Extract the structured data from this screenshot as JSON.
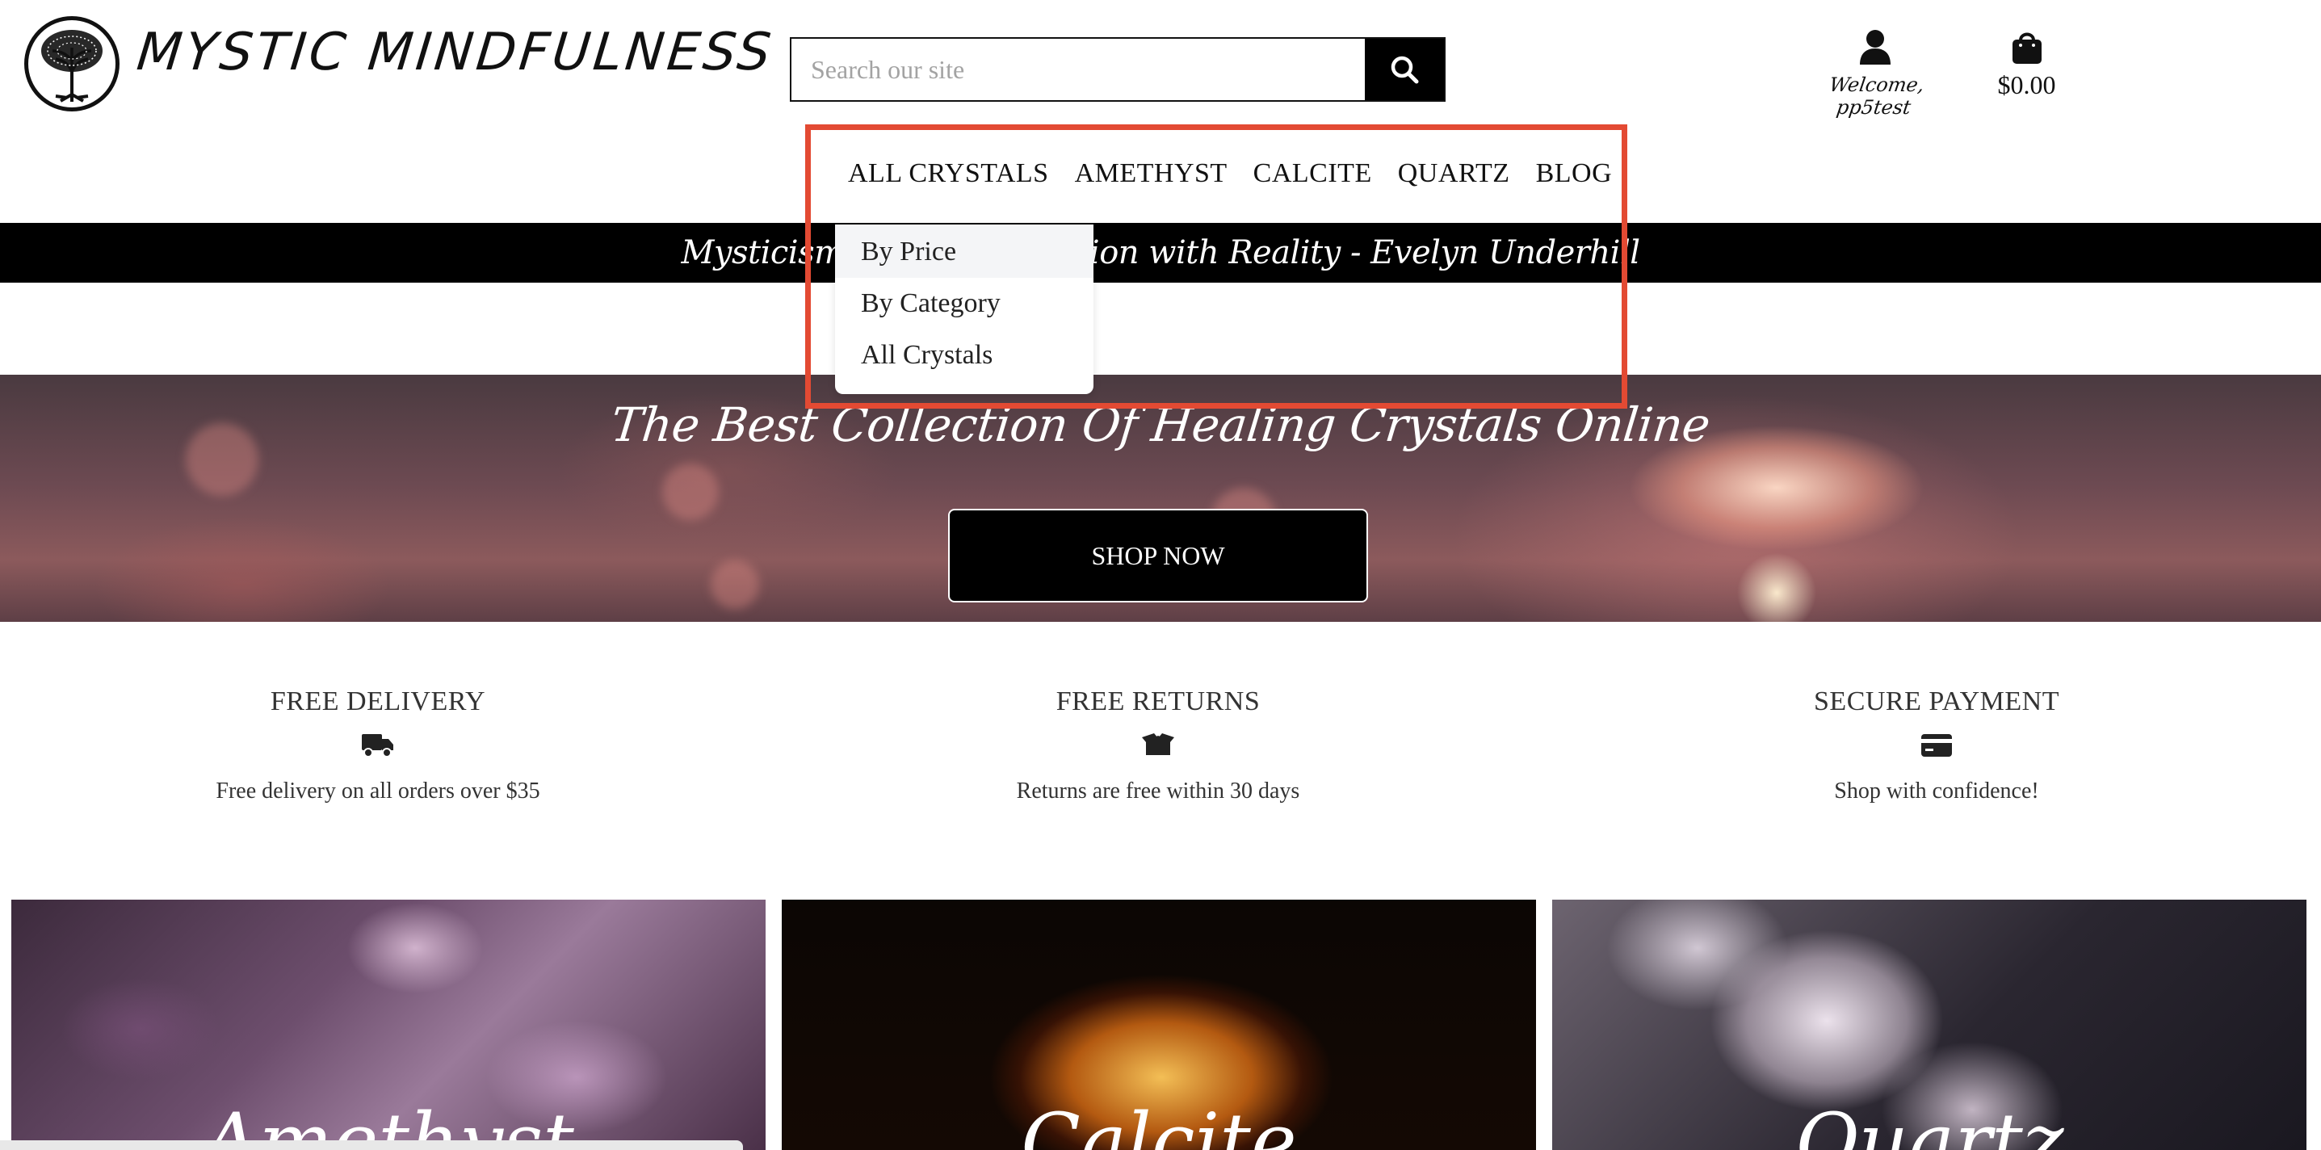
{
  "brand": {
    "name": "MYSTIC MINDFULNESS",
    "logo_icon": "tree-of-life-icon"
  },
  "search": {
    "placeholder": "Search our site",
    "value": "",
    "button_icon": "search-icon"
  },
  "account": {
    "icon": "user-icon",
    "label": "Welcome, pp5test"
  },
  "cart": {
    "icon": "shopping-bag-icon",
    "total": "$0.00"
  },
  "nav": {
    "items": [
      {
        "label": "ALL CRYSTALS"
      },
      {
        "label": "AMETHYST"
      },
      {
        "label": "CALCITE"
      },
      {
        "label": "QUARTZ"
      },
      {
        "label": "BLOG"
      }
    ]
  },
  "dropdown": {
    "items": [
      {
        "label": "By Price",
        "active": true
      },
      {
        "label": "By Category",
        "active": false
      },
      {
        "label": "All Crystals",
        "active": false
      }
    ]
  },
  "quote_banner": {
    "text": "Mysticism is the art of union with Reality - Evelyn Underhill"
  },
  "hero": {
    "title": "The Best Collection Of Healing Crystals Online",
    "cta_label": "SHOP NOW"
  },
  "features": [
    {
      "title": "FREE DELIVERY",
      "icon": "truck-icon",
      "description": "Free delivery on all orders over $35"
    },
    {
      "title": "FREE RETURNS",
      "icon": "box-open-icon",
      "description": "Returns are free within 30 days"
    },
    {
      "title": "SECURE PAYMENT",
      "icon": "credit-card-icon",
      "description": "Shop with confidence!"
    }
  ],
  "category_tiles": [
    {
      "name": "Amethyst",
      "label": "Amethyst"
    },
    {
      "name": "Calcite",
      "label": "Calcite"
    },
    {
      "name": "Quartz",
      "label": "Quartz"
    }
  ],
  "colors": {
    "black": "#000000",
    "highlight": "#e34a33",
    "dropdown_active_bg": "#f4f5f7",
    "placeholder": "#a3a3a3"
  }
}
